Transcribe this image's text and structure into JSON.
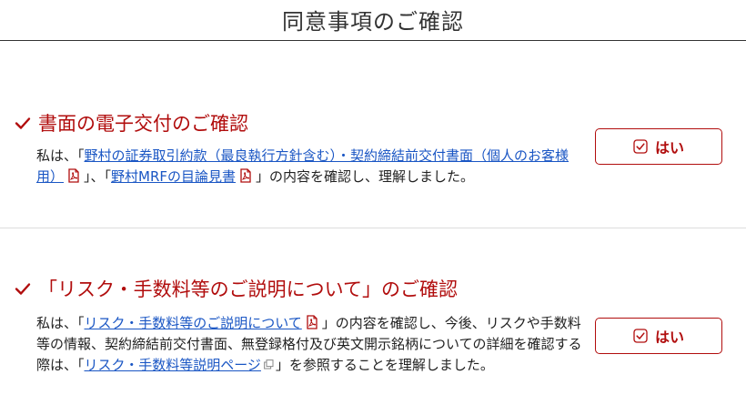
{
  "header": {
    "title": "同意事項のご確認"
  },
  "section1": {
    "title": "書面の電子交付のご確認",
    "text_prefix": "私は、「",
    "link1": "野村の証券取引約款（最良執行方針含む）・契約締結前交付書面（個人のお客様用）",
    "text_middle": "」、「",
    "link2": "野村MRFの目論見書",
    "text_suffix": "」の内容を確認し、理解しました。",
    "button_label": "はい"
  },
  "section2": {
    "title": "「リスク・手数料等のご説明について」のご確認",
    "text_prefix": "私は、「",
    "link1": "リスク・手数料等のご説明について",
    "text_middle": "」の内容を確認し、今後、リスクや手数料等の情報、契約締結前交付書面、無登録格付及び英文開示銘柄についての詳細を確認する際は、「",
    "link2": "リスク・手数料等説明ページ",
    "text_suffix": "」を参照することを理解しました。",
    "button_label": "はい"
  },
  "icons": {
    "check": "check-icon",
    "pdf": "pdf-icon",
    "external": "external-link-icon",
    "checkbox": "checkbox-checked-icon"
  },
  "colors": {
    "accent": "#b10d0d",
    "link": "#1a56c4"
  }
}
